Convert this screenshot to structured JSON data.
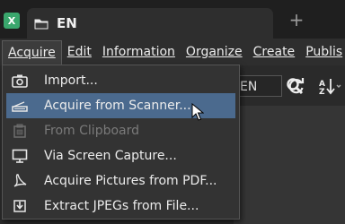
{
  "tab": {
    "title": "EN"
  },
  "menubar": {
    "items": [
      {
        "label": "Acquire",
        "underline": "A"
      },
      {
        "label": "Edit"
      },
      {
        "label": "Information"
      },
      {
        "label": "Organize"
      },
      {
        "label": "Create"
      },
      {
        "label": "Publis"
      }
    ]
  },
  "toolbar": {
    "language_field": "EN"
  },
  "dropdown": {
    "items": [
      {
        "label": "Import...",
        "icon": "camera-icon",
        "state": "normal"
      },
      {
        "label": "Acquire from Scanner...",
        "icon": "scanner-icon",
        "state": "highlighted"
      },
      {
        "label": "From Clipboard",
        "icon": "clipboard-icon",
        "state": "disabled"
      },
      {
        "label": "Via Screen Capture...",
        "icon": "monitor-icon",
        "state": "normal"
      },
      {
        "label": "Acquire Pictures from PDF...",
        "icon": "pdf-icon",
        "state": "normal"
      },
      {
        "label": "Extract JPEGs from File...",
        "icon": "extract-icon",
        "state": "normal"
      }
    ]
  },
  "colors": {
    "highlight": "#4b6a8e",
    "app_icon": "#3aa76d",
    "folder": "#d7b25a"
  }
}
